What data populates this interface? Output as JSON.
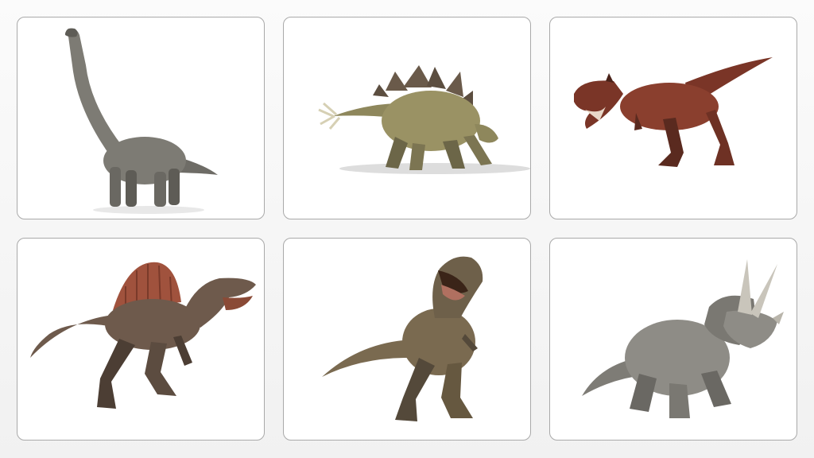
{
  "gallery": {
    "cards": [
      {
        "icon": "brachiosaurus-icon",
        "body_color": "#7d7b74",
        "shade_color": "#5e5c56"
      },
      {
        "icon": "stegosaurus-icon",
        "body_color": "#9a9264",
        "shade_color": "#6c6648",
        "plate_color": "#6a5a4a"
      },
      {
        "icon": "carnotaurus-icon",
        "body_color": "#8a3f2e",
        "shade_color": "#5a2a1f"
      },
      {
        "icon": "spinosaurus-icon",
        "body_color": "#6e5a4c",
        "shade_color": "#4c3e34",
        "sail_color": "#a0523d"
      },
      {
        "icon": "tyrannosaurus-icon",
        "body_color": "#7a6a50",
        "shade_color": "#54493a"
      },
      {
        "icon": "triceratops-icon",
        "body_color": "#8e8c86",
        "shade_color": "#6a6863",
        "horn_color": "#c9c5bb"
      }
    ]
  }
}
